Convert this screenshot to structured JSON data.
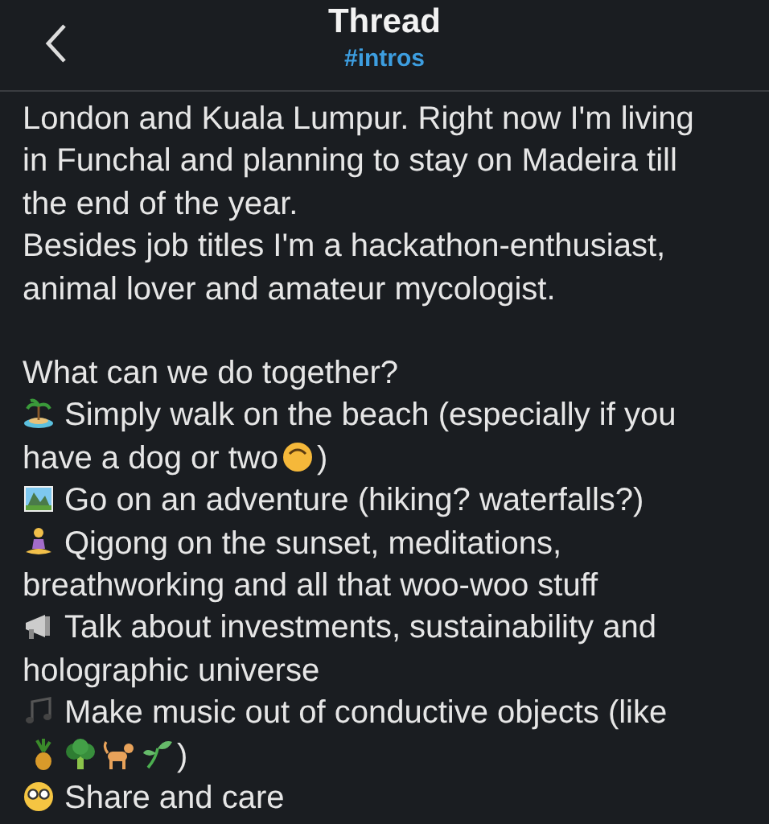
{
  "header": {
    "title": "Thread",
    "channel": "#intros"
  },
  "paragraphs": [
    "London and Kuala Lumpur. Right now I'm living in Funchal and planning to stay on Madeira till the end of the year.",
    "Besides job titles I'm a hackathon-enthusiast, animal lover and amateur mycologist."
  ],
  "heading": "What can we do together?",
  "items": [
    {
      "lines": [
        "Simply walk on the beach (especially if you",
        "have a dog or two"
      ],
      "tail": ")"
    },
    {
      "lines": [
        "Go on an adventure (hiking? waterfalls?)"
      ]
    },
    {
      "lines": [
        "Qigong on the sunset, meditations,",
        "breathworking and all that woo-woo stuff"
      ]
    },
    {
      "lines": [
        "Talk about investments, sustainability and",
        "holographic universe"
      ]
    },
    {
      "lines": [
        "Make music out of conductive objects (like"
      ],
      "tail": ")"
    },
    {
      "lines": [
        "Share and care"
      ]
    }
  ]
}
